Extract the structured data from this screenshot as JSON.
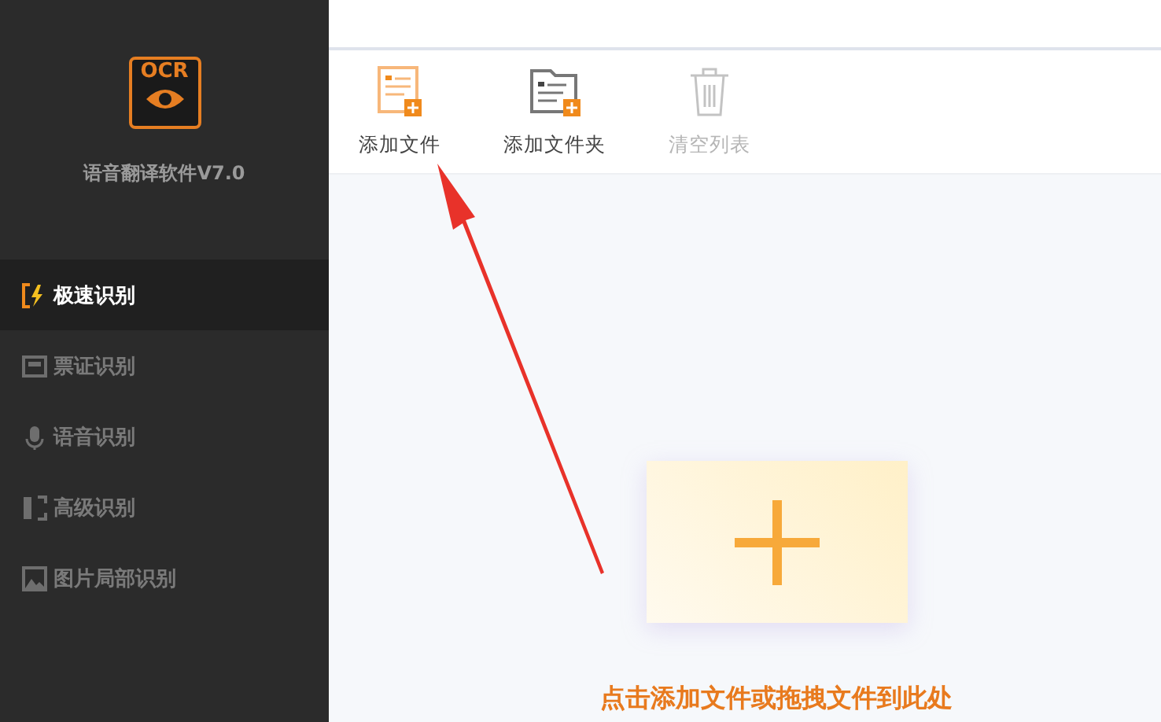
{
  "logo": {
    "text": "OCR"
  },
  "app_name": "语音翻译软件V7.0",
  "sidebar": {
    "items": [
      {
        "label": "极速识别",
        "kind": "fast",
        "selected": true
      },
      {
        "label": "票证识别",
        "kind": "ticket",
        "selected": false
      },
      {
        "label": "语音识别",
        "kind": "voice",
        "selected": false
      },
      {
        "label": "高级识别",
        "kind": "advanced",
        "selected": false
      },
      {
        "label": "图片局部识别",
        "kind": "region",
        "selected": false
      }
    ]
  },
  "toolbar": [
    {
      "label": "添加文件",
      "kind": "file",
      "disabled": false
    },
    {
      "label": "添加文件夹",
      "kind": "folder",
      "disabled": false
    },
    {
      "label": "清空列表",
      "kind": "trash",
      "disabled": true
    }
  ],
  "drop_zone": {
    "hint": "点击添加文件或拖拽文件到此处"
  }
}
